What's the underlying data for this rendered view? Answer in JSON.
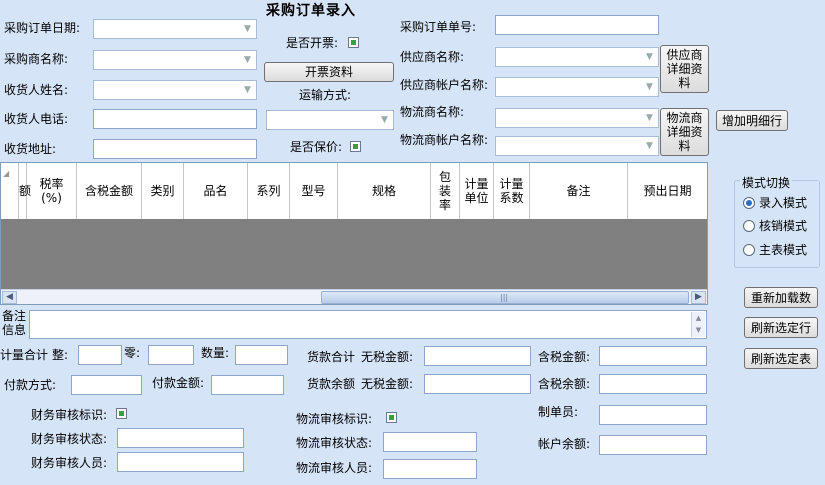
{
  "title": "采购订单录入",
  "left_form": {
    "order_date": "采购订单日期:",
    "buyer_name": "采购商名称:",
    "receiver_name": "收货人姓名:",
    "receiver_phone": "收货人电话:",
    "receiver_address": "收货地址:"
  },
  "middle": {
    "invoice_label": "是否开票:",
    "invoice_button": "开票资料",
    "transport_label": "运输方式:",
    "insure_label": "是否保价:"
  },
  "right_form": {
    "order_no": "采购订单单号:",
    "supplier_name": "供应商名称:",
    "supplier_account": "供应商帐户名称:",
    "logistics_name": "物流商名称:",
    "logistics_account": "物流商帐户名称:",
    "supplier_detail_btn": "供应商\n详细资\n料",
    "logistics_detail_btn": "物流商\n详细资\n料",
    "add_row_btn": "增加明细行"
  },
  "grid": {
    "columns": [
      "额",
      "税率\n(%)",
      "含税金额",
      "类别",
      "品名",
      "系列",
      "型号",
      "规格",
      "包\n装\n率",
      "计量\n单位",
      "计量\n系数",
      "备注",
      "预出日期"
    ]
  },
  "mode": {
    "title": "模式切换",
    "options": [
      "录入模式",
      "核销模式",
      "主表模式"
    ],
    "selected": 0
  },
  "side_buttons": {
    "reload": "重新加载数",
    "refresh_row": "刷新选定行",
    "refresh_table": "刷新选定表"
  },
  "notes": {
    "label": "备注\n信息"
  },
  "totals": {
    "qty_total": "计量合计",
    "whole": "整:",
    "part": "零:",
    "count": "数量:",
    "goods_total": "货款合计",
    "untaxed_amount": "无税金额:",
    "taxed_amount": "含税金额:",
    "pay_method": "付款方式:",
    "pay_amount": "付款金额:",
    "goods_balance": "货款余额",
    "untaxed_balance": "无税金额:",
    "taxed_balance": "含税余额:"
  },
  "audit": {
    "fin_flag": "财务审核标识:",
    "fin_status": "财务审核状态:",
    "fin_person": "财务审核人员:",
    "log_flag": "物流审核标识:",
    "log_status": "物流审核状态:",
    "log_person": "物流审核人员:",
    "maker": "制单员:",
    "account_balance": "帐户余额:"
  }
}
